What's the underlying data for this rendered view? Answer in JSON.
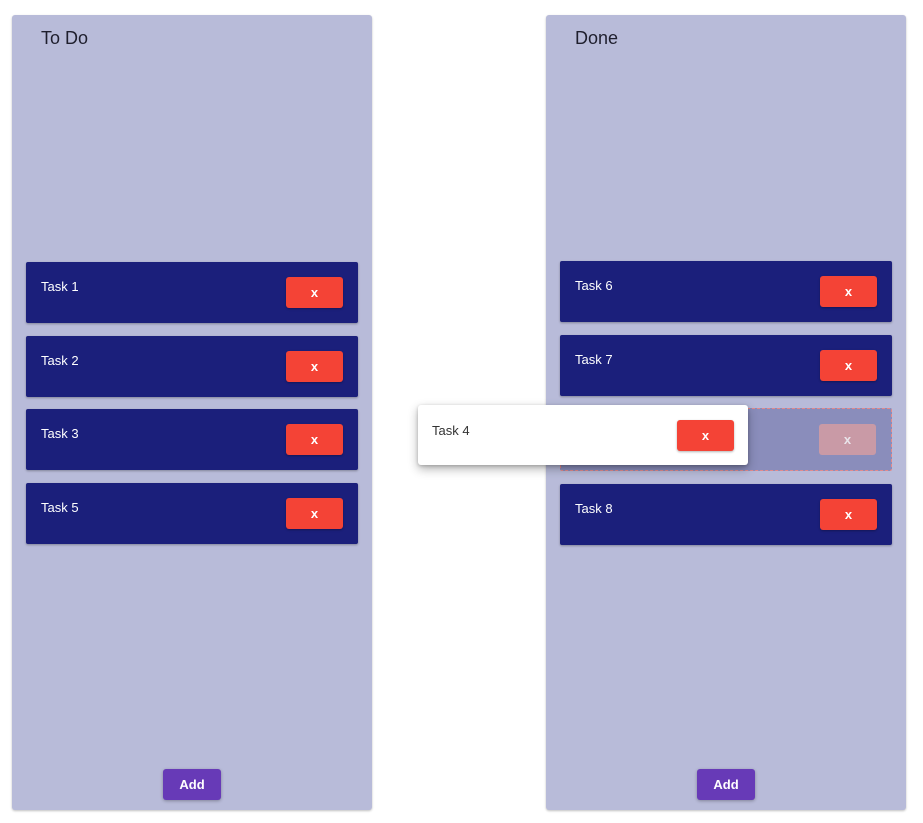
{
  "board": {
    "columns": [
      {
        "title": "To Do",
        "cards": [
          {
            "label": "Task 1",
            "delete_label": "x"
          },
          {
            "label": "Task 2",
            "delete_label": "x"
          },
          {
            "label": "Task 3",
            "delete_label": "x"
          },
          {
            "label": "Task 5",
            "delete_label": "x"
          }
        ],
        "add_label": "Add"
      },
      {
        "title": "Done",
        "cards": [
          {
            "label": "Task 6",
            "delete_label": "x"
          },
          {
            "label": "Task 7",
            "delete_label": "x"
          },
          {
            "label": "Task 8",
            "delete_label": "x"
          }
        ],
        "placeholder": {
          "delete_label": "x"
        },
        "add_label": "Add"
      }
    ],
    "dragging": {
      "label": "Task 4",
      "delete_label": "x"
    }
  },
  "colors": {
    "column_bg": "#b8bbd9",
    "card_bg": "#1b1f7b",
    "delete_button": "#f44336",
    "add_button": "#673ab7",
    "placeholder_bg": "#8a8dbb"
  }
}
